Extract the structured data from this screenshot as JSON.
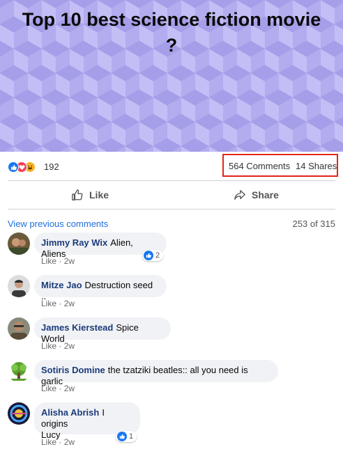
{
  "post": {
    "title": "Top 10 best science fiction movie ?",
    "reaction_icons": [
      "like-icon",
      "love-icon",
      "haha-icon"
    ],
    "reaction_count": "192",
    "comments_count": "564 Comments",
    "shares_count": "14 Shares"
  },
  "actions": {
    "like_label": "Like",
    "share_label": "Share"
  },
  "comments_section": {
    "view_previous_label": "View previous comments",
    "page_count": "253 of 315",
    "comments": [
      {
        "author": "Jimmy Ray Wix",
        "text": "Alien, Aliens",
        "like_label": "Like",
        "separator": "·",
        "time": "2w",
        "like_count": "2"
      },
      {
        "author": "Mitze Jao",
        "text": "Destruction seed ..",
        "like_label": "Like",
        "separator": "·",
        "time": "2w"
      },
      {
        "author": "James Kierstead",
        "text": "Spice World",
        "like_label": "Like",
        "separator": "·",
        "time": "2w"
      },
      {
        "author": "Sotiris Domine",
        "text": "the tzatziki beatles:: all you need is garlic",
        "like_label": "Like",
        "separator": "·",
        "time": "2w"
      },
      {
        "author": "Alisha Abrish",
        "text": "I origins",
        "text_line2": "Lucy",
        "like_label": "Like",
        "separator": "·",
        "time": "2w",
        "like_count": "1"
      }
    ]
  },
  "colors": {
    "accent": "#1877f2",
    "author": "#1c3b7a",
    "highlight_box": "#e0261a"
  }
}
